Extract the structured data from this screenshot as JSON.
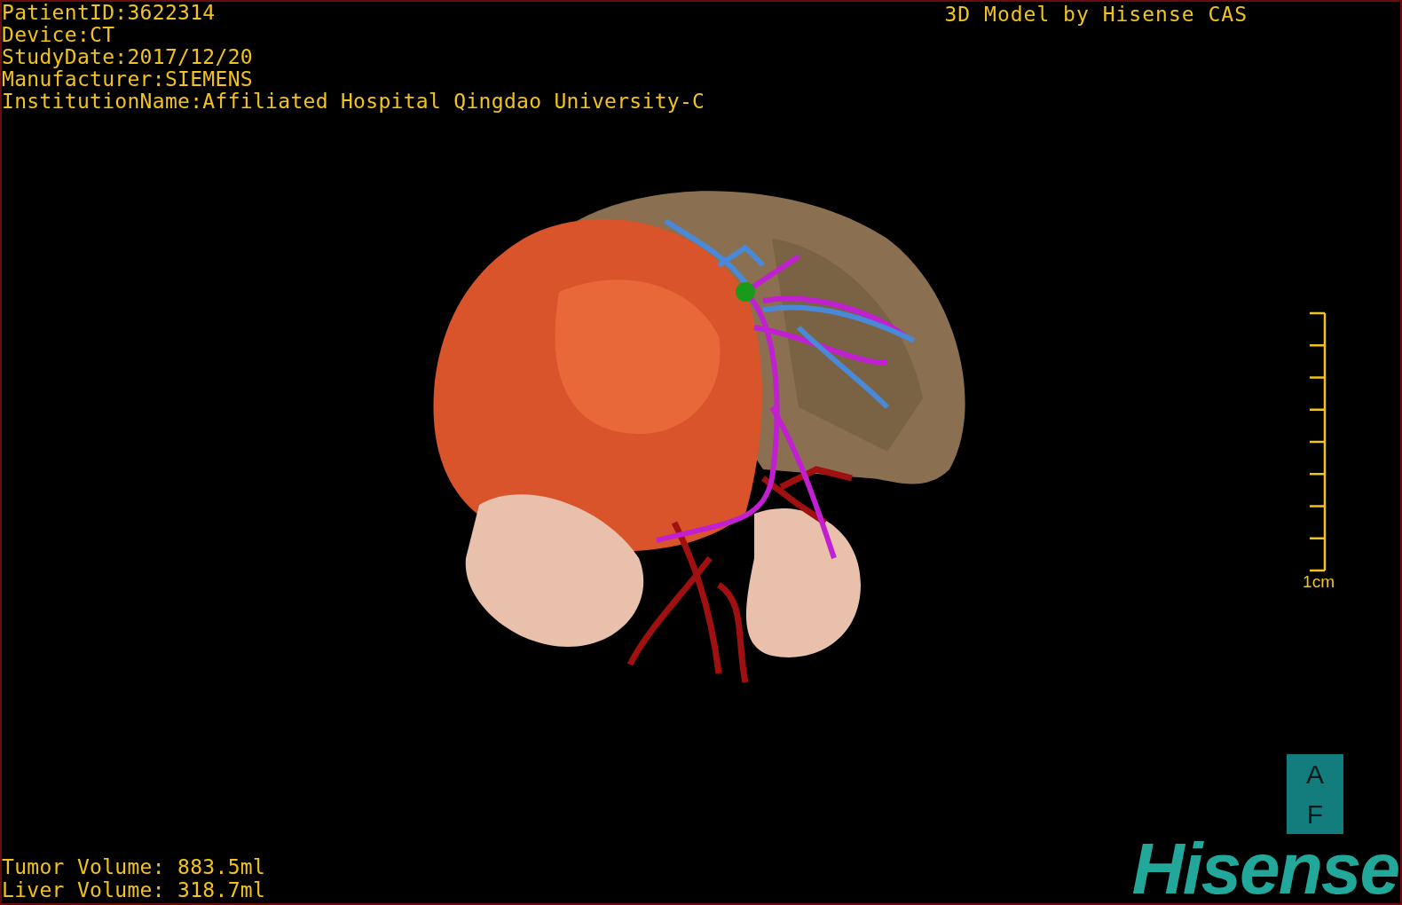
{
  "study_info": [
    "PatientID:3622314",
    "Device:CT",
    "StudyDate:2017/12/20",
    "Manufacturer:SIEMENS",
    "InstitutionName:Affiliated Hospital Qingdao University-C"
  ],
  "title": "3D Model by Hisense CAS",
  "scale_bar": {
    "label": "1cm"
  },
  "volumes": [
    "Tumor Volume: 883.5ml",
    "Liver Volume: 318.7ml"
  ],
  "orientation": [
    "A",
    "F"
  ],
  "logo": "Hisense"
}
